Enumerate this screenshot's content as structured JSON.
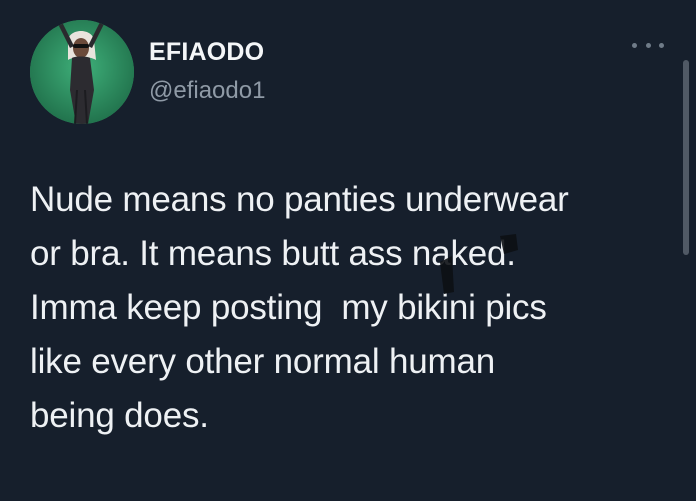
{
  "tweet": {
    "author": {
      "display_name": "EFIAODO",
      "handle": "@efiaodo1",
      "avatar": "profile-photo"
    },
    "menu_icon": "more-options-icon",
    "text_lines": [
      "Nude means no panties underwear",
      "or bra. It means butt ass naked.",
      "Imma keep posting  my bikini pics",
      "like every other normal human",
      "being does."
    ]
  },
  "colors": {
    "background": "#161f2c",
    "primary_text": "#eef1f4",
    "secondary_text": "#8f9aa6"
  }
}
